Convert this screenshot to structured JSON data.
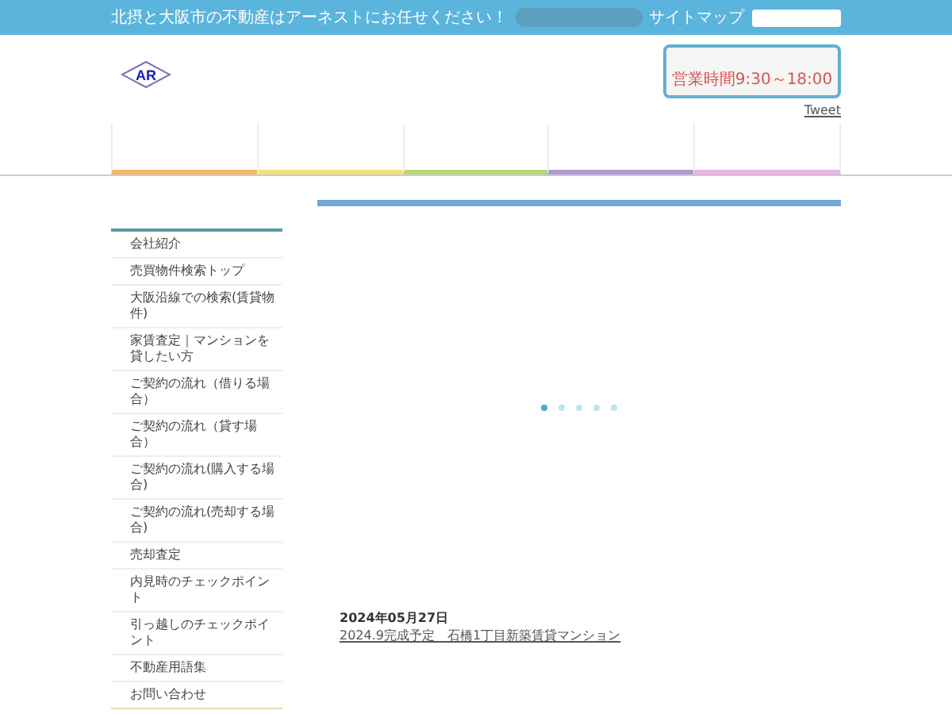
{
  "top_bar": {
    "tagline": "北摂と大阪市の不動産はアーネストにお任せください！",
    "sitemap_link": "サイトマップ"
  },
  "header": {
    "logo_text": "AR",
    "hours": "営業時間9:30～18:00",
    "tweet_link": "Tweet"
  },
  "nav_tabs": [
    {
      "color": "#f5b66a"
    },
    {
      "color": "#f2e27c"
    },
    {
      "color": "#b6d87a"
    },
    {
      "color": "#b09ccf"
    },
    {
      "color": "#e8b4e6"
    }
  ],
  "sidebar": {
    "items": [
      {
        "label": "会社紹介"
      },
      {
        "label": "売買物件検索トップ"
      },
      {
        "label": "大阪沿線での検索(賃貸物件)"
      },
      {
        "label": "家賃査定｜マンションを貸したい方"
      },
      {
        "label": "ご契約の流れ（借りる場合）"
      },
      {
        "label": "ご契約の流れ（貸す場合）"
      },
      {
        "label": "ご契約の流れ(購入する場合)"
      },
      {
        "label": "ご契約の流れ(売却する場合)"
      },
      {
        "label": "売却査定"
      },
      {
        "label": "内見時のチェックポイント"
      },
      {
        "label": "引っ越しのチェックポイント"
      },
      {
        "label": "不動産用語集"
      },
      {
        "label": "お問い合わせ"
      }
    ]
  },
  "slider": {
    "dots": [
      {
        "selected": true
      },
      {
        "selected": false
      },
      {
        "selected": false
      },
      {
        "selected": false
      },
      {
        "selected": false
      }
    ]
  },
  "news": [
    {
      "date": "2024年05月27日",
      "title": "2024.9完成予定　石橋1丁目新築賃貸マンション"
    }
  ]
}
